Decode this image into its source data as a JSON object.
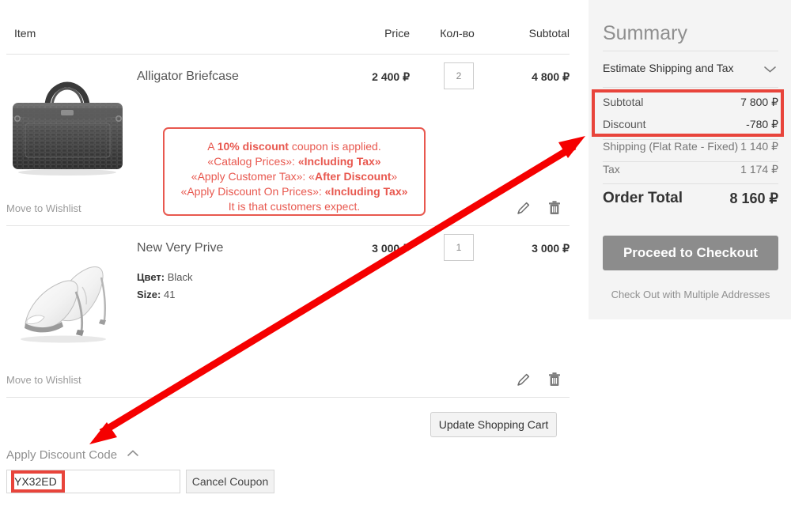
{
  "cart": {
    "columns": {
      "item": "Item",
      "price": "Price",
      "qty": "Кол-во",
      "subtotal": "Subtotal"
    },
    "wishlist_label": "Move to Wishlist",
    "items": [
      {
        "name": "Alligator Briefcase",
        "price": "2 400 ₽",
        "qty": "2",
        "subtotal": "4 800 ₽",
        "image": "briefcase-thumbnail"
      },
      {
        "name": "New Very Prive",
        "price": "3 000 ₽",
        "qty": "1",
        "subtotal": "3 000 ₽",
        "image": "high-heel-shoe-thumbnail",
        "options": [
          {
            "label": "Цвет:",
            "value": "Black"
          },
          {
            "label": "Size:",
            "value": "41"
          }
        ]
      }
    ],
    "edit_icon": "pencil-icon",
    "delete_icon": "trash-icon",
    "update_button": "Update Shopping Cart"
  },
  "discount": {
    "toggle_label": "Apply Discount Code",
    "toggle_icon": "chevron-up-icon",
    "code_value": "YX32ED",
    "cancel_button": "Cancel Coupon"
  },
  "summary": {
    "title": "Summary",
    "estimate_label": "Estimate Shipping and Tax",
    "estimate_icon": "chevron-down-icon",
    "rows": [
      {
        "label": "Subtotal",
        "value": "7 800 ₽",
        "muted": false
      },
      {
        "label": "Discount",
        "value": "-780 ₽",
        "muted": false
      },
      {
        "label": "Shipping (Flat Rate - Fixed)",
        "value": "1 140 ₽",
        "muted": true
      },
      {
        "label": "Tax",
        "value": "1 174 ₽",
        "muted": true
      }
    ],
    "order_total_label": "Order Total",
    "order_total_value": "8 160 ₽",
    "checkout_button": "Proceed to Checkout",
    "multiple_addresses": "Check Out with Multiple Addresses"
  },
  "annotation": {
    "line1_pre": "A ",
    "line1_bold": "10% discount",
    "line1_post": " coupon is applied.",
    "line2_pre": "«Catalog Prices»: ",
    "line2_bold": "«Including Tax»",
    "line3_pre": "«Apply Customer Tax»: «",
    "line3_bold": "After Discount",
    "line3_post": "»",
    "line4_pre": "«Apply Discount On Prices»: ",
    "line4_bold": "«Including Tax»",
    "line5": "It is that customers expect.",
    "arrow": "double-headed-red-arrow"
  },
  "colors": {
    "highlight_red": "#e8443b",
    "callout_red": "#e8584f",
    "summary_bg": "#f4f4f4",
    "checkout_btn": "#8c8c8c"
  }
}
